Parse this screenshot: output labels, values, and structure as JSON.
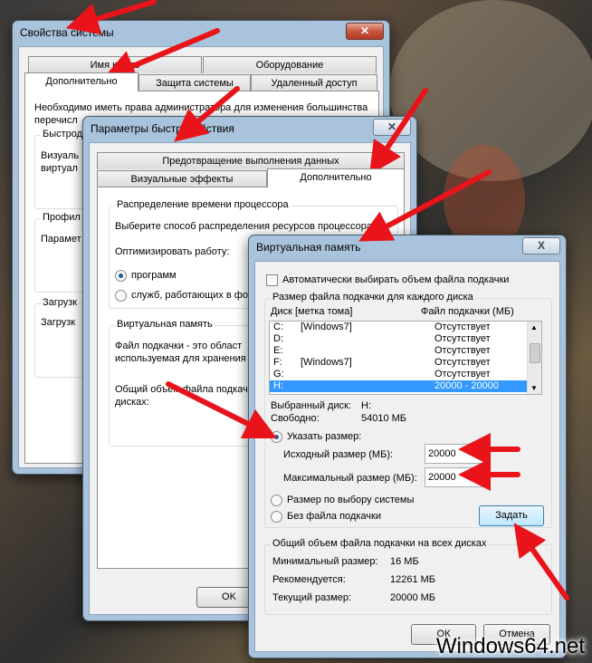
{
  "system_props": {
    "title": "Свойства системы",
    "tabs_back": [
      "Имя компь",
      "Оборудование"
    ],
    "tabs_front": [
      "Дополнительно",
      "Защита системы",
      "Удаленный доступ"
    ],
    "text_line1": "Необходимо иметь права администратора для изменения большинства",
    "text_line2": "перечисл",
    "perf_group": "Быстрод",
    "perf_text1": "Визуаль",
    "perf_text2": "виртуал",
    "profile_group": "Профил",
    "profile_text": "Парамет",
    "boot_group": "Загрузк",
    "boot_text": "Загрузк"
  },
  "perf_options": {
    "title": "Параметры быстродействия",
    "tab_dep": "Предотвращение выполнения данных",
    "tab_visual": "Визуальные эффекты",
    "tab_advanced": "Дополнительно",
    "cpu_group": "Распределение времени процессора",
    "cpu_text": "Выберите способ распределения ресурсов процессора",
    "optimize_label": "Оптимизировать работу:",
    "radio_programs": "программ",
    "radio_services": "служб, работающих в фо",
    "vm_group": "Виртуальная память",
    "vm_text1": "Файл подкачки - это област",
    "vm_text2": "используемая для хранения",
    "vm_text3": "Общий объем файла подкач",
    "vm_text4": "дисках:",
    "ok": "OK"
  },
  "virtual_memory": {
    "title": "Виртуальная память",
    "close": "X",
    "auto_checkbox": "Автоматически выбирать объем файла подкачки",
    "drives_group": "Размер файла подкачки для каждого диска",
    "col_drive": "Диск [метка тома]",
    "col_size": "Файл подкачки (МБ)",
    "drives": [
      {
        "drive": "C:",
        "label": "[Windows7]",
        "size": "Отсутствует"
      },
      {
        "drive": "D:",
        "label": "",
        "size": "Отсутствует"
      },
      {
        "drive": "E:",
        "label": "",
        "size": "Отсутствует"
      },
      {
        "drive": "F:",
        "label": "[Windows7]",
        "size": "Отсутствует"
      },
      {
        "drive": "G:",
        "label": "",
        "size": "Отсутствует"
      },
      {
        "drive": "H:",
        "label": "",
        "size": "20000 - 20000"
      }
    ],
    "selected_drive_label": "Выбранный диск:",
    "selected_drive_value": "H:",
    "free_label": "Свободно:",
    "free_value": "54010 МБ",
    "radio_custom": "Указать размер:",
    "initial_label": "Исходный размер (МБ):",
    "initial_value": "20000",
    "max_label": "Максимальный размер (МБ):",
    "max_value": "20000",
    "radio_system": "Размер по выбору системы",
    "radio_none": "Без файла подкачки",
    "set_button": "Задать",
    "total_group": "Общий объем файла подкачки на всех дисках",
    "min_label": "Минимальный размер:",
    "min_value": "16 МБ",
    "rec_label": "Рекомендуется:",
    "rec_value": "12261 МБ",
    "cur_label": "Текущий размер:",
    "cur_value": "20000 МБ",
    "ok": "ОК",
    "cancel": "Отмена"
  },
  "watermark": "Windows64.net",
  "colors": {
    "arrow": "#e8141a",
    "accent": "#3399ff"
  }
}
